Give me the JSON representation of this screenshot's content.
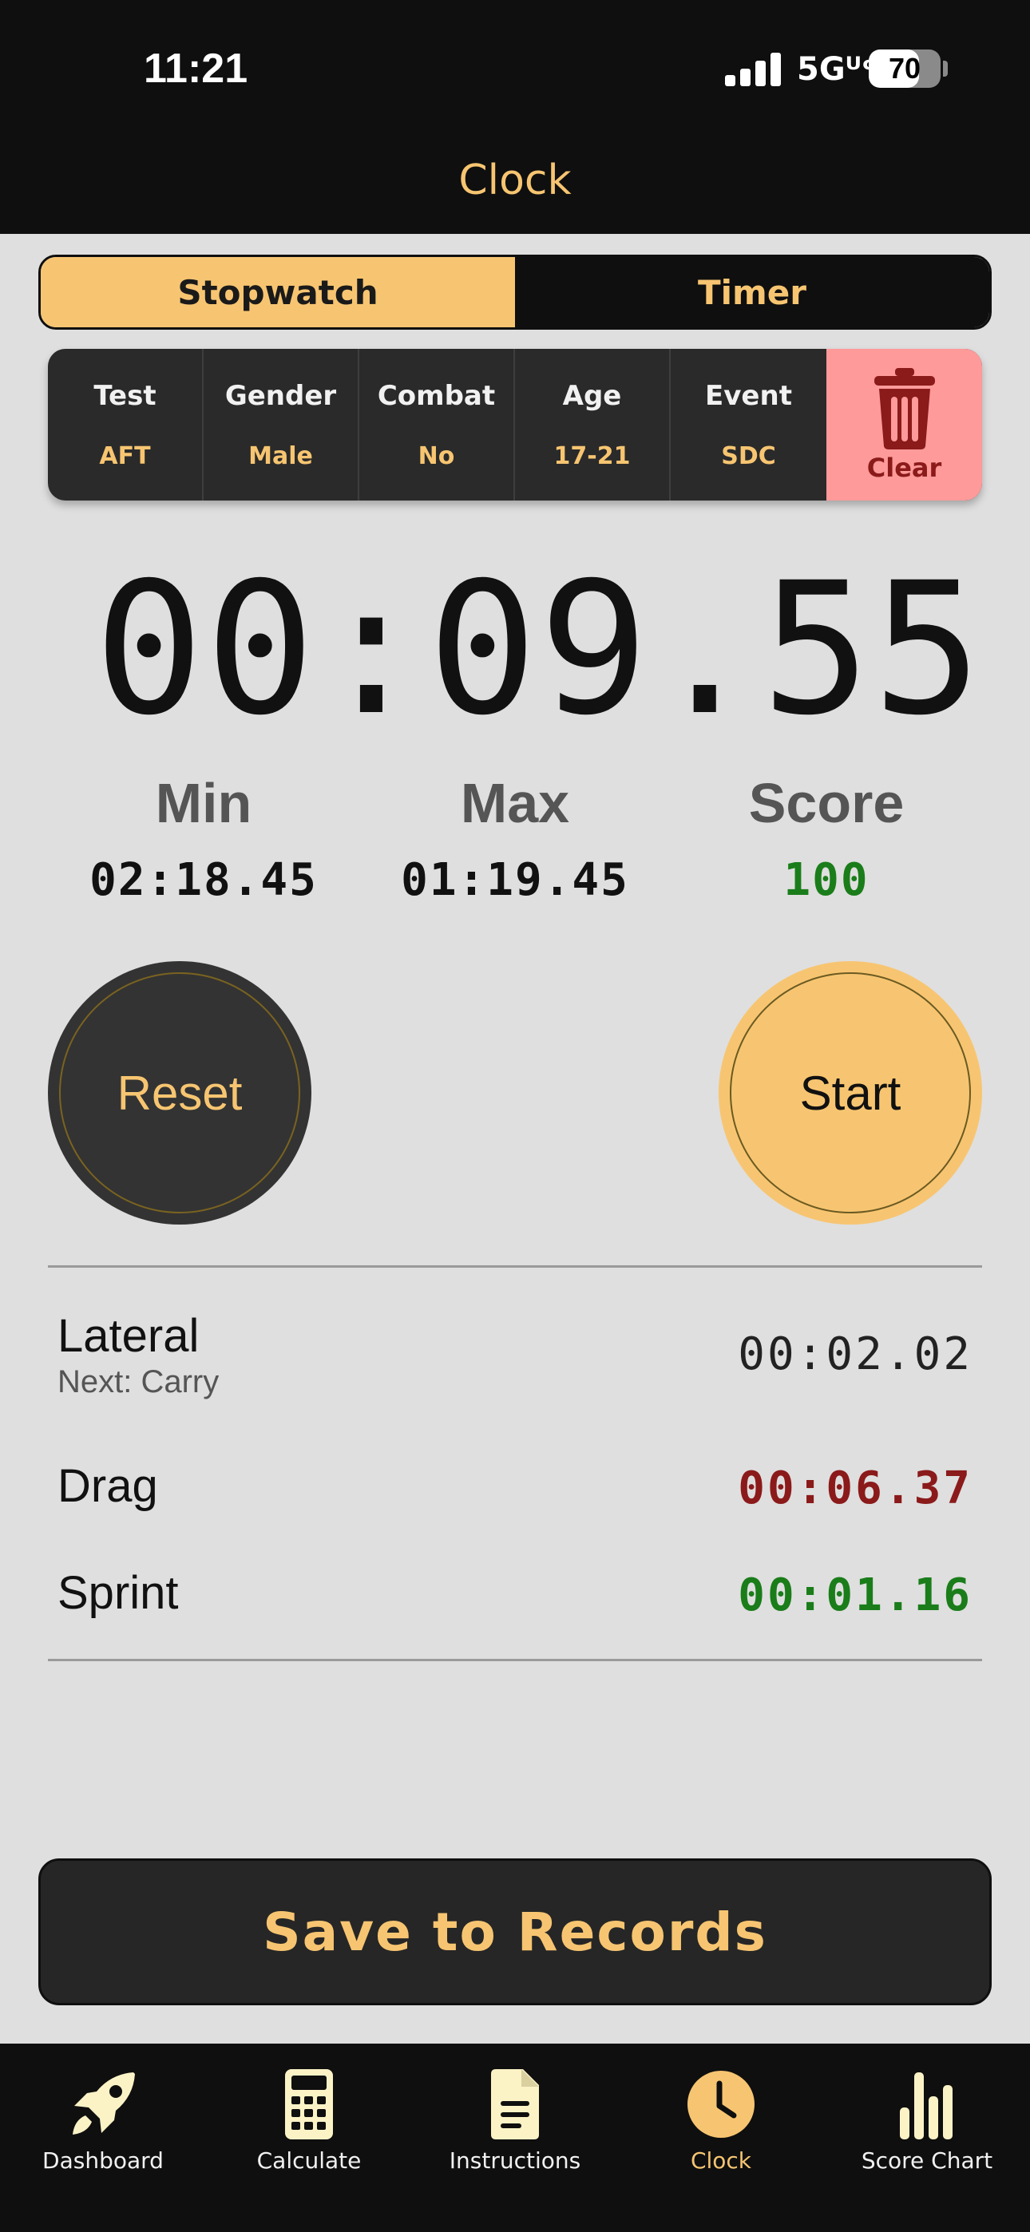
{
  "status": {
    "time": "11:21",
    "network": "5Gᵁᶜ",
    "battery": "70",
    "battery_level": 0.7
  },
  "header": {
    "title": "Clock"
  },
  "segment": {
    "active": "Stopwatch",
    "inactive": "Timer"
  },
  "info": {
    "items": [
      {
        "label": "Test",
        "value": "AFT"
      },
      {
        "label": "Gender",
        "value": "Male"
      },
      {
        "label": "Combat",
        "value": "No"
      },
      {
        "label": "Age",
        "value": "17-21"
      },
      {
        "label": "Event",
        "value": "SDC"
      }
    ],
    "clear_label": "Clear"
  },
  "stopwatch": {
    "display": "00:09.55"
  },
  "stats": {
    "min_label": "Min",
    "min_value": "02:18.45",
    "max_label": "Max",
    "max_value": "01:19.45",
    "score_label": "Score",
    "score_value": "100"
  },
  "buttons": {
    "reset": "Reset",
    "start": "Start"
  },
  "laps": [
    {
      "name": "Lateral",
      "sub": "Next: Carry",
      "time": "00:02.02"
    },
    {
      "name": "Drag",
      "time": "00:06.37"
    },
    {
      "name": "Sprint",
      "time": "00:01.16"
    }
  ],
  "save_label": "Save to Records",
  "tabs": [
    {
      "label": "Dashboard",
      "icon": "rocket-icon"
    },
    {
      "label": "Calculate",
      "icon": "calculator-icon"
    },
    {
      "label": "Instructions",
      "icon": "document-icon"
    },
    {
      "label": "Clock",
      "icon": "clock-icon"
    },
    {
      "label": "Score Chart",
      "icon": "bar-chart-icon"
    }
  ],
  "colors": {
    "accent": "#f7c571",
    "dark": "#0f0f0f",
    "clear_bg": "#fe9a9a",
    "green": "#1a7d1a",
    "red": "#8b1a1a"
  }
}
